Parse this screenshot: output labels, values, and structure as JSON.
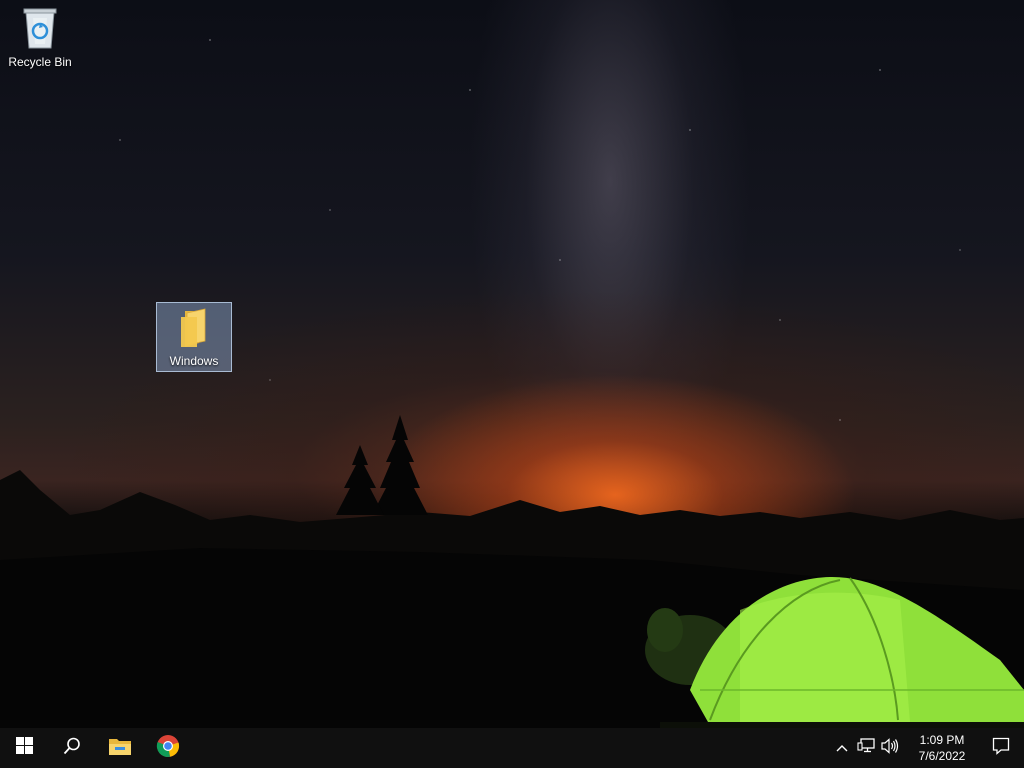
{
  "desktop": {
    "icons": [
      {
        "label": "Recycle Bin",
        "icon": "recycle-bin-icon"
      },
      {
        "label": "Windows",
        "icon": "folder-icon",
        "selected": true
      }
    ]
  },
  "taskbar": {
    "items": [
      {
        "name": "start",
        "icon": "windows-logo-icon"
      },
      {
        "name": "search",
        "icon": "search-icon"
      },
      {
        "name": "file-explorer",
        "icon": "file-explorer-icon"
      },
      {
        "name": "chrome",
        "icon": "chrome-icon"
      }
    ],
    "tray": {
      "icons": [
        "chevron-up-icon",
        "network-icon",
        "volume-icon"
      ],
      "time": "1:09 PM",
      "date": "7/6/2022",
      "notification_icon": "action-center-icon"
    }
  },
  "colors": {
    "taskbar": "#101010",
    "tent_green": "#8fe03a",
    "horizon_glow": "#ff6e1e",
    "selection": "#96b4dc"
  }
}
